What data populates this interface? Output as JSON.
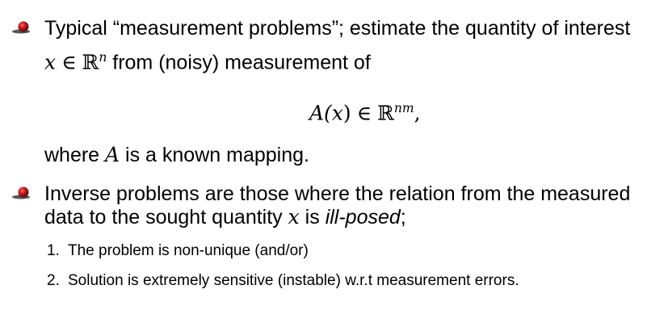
{
  "bullets": [
    {
      "line1": "Typical “measurement problems”; estimate the quantity of interest",
      "line2_var": "x",
      "line2_in": "∈",
      "line2_set": "ℝ",
      "line2_exp": "n",
      "line2_text": " from (noisy) measurement of",
      "equation": {
        "func": "A(",
        "var": "x",
        "close": ")",
        "in": "∈",
        "set": "ℝ",
        "exp": "nm",
        "punct": ","
      },
      "after_pre": "where ",
      "after_var": "A",
      "after_post": " is a known mapping."
    },
    {
      "line1": "Inverse problems are those where the relation from the measured",
      "line2_pre": "data to the sought quantity ",
      "line2_var": "x",
      "line2_mid": " is ",
      "line2_em": "ill-posed",
      "line2_post": ";"
    }
  ],
  "numbered_items": [
    {
      "num": "1.",
      "text": "The problem is non-unique (and/or)"
    },
    {
      "num": "2.",
      "text": "Solution is extremely sensitive (instable) w.r.t measurement errors."
    }
  ],
  "colors": {
    "bullet_red": "#c0141a",
    "bullet_dark": "#5a0d0d",
    "text": "#000000"
  }
}
